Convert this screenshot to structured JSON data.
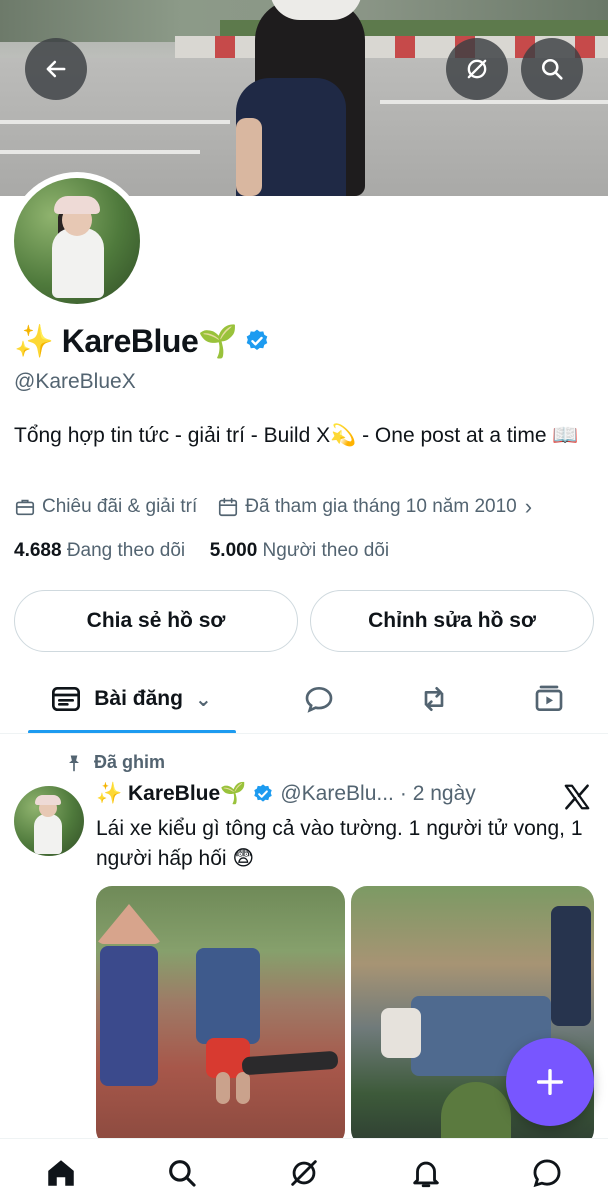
{
  "profile": {
    "name": "KareBlue",
    "name_prefix_emoji": "✨",
    "name_suffix_emoji": "🌱",
    "handle": "@KareBlueX",
    "bio": "Tổng hợp tin tức - giải trí - Build X💫 - One post at a time 📖",
    "category": "Chiêu đãi & giải trí",
    "joined": "Đã tham gia tháng 10 năm 2010",
    "following_count": "4.688",
    "following_label": "Đang theo dõi",
    "followers_count": "5.000",
    "followers_label": "Người theo dõi",
    "verified": true
  },
  "actions": {
    "share_label": "Chia sẻ hồ sơ",
    "edit_label": "Chỉnh sửa hồ sơ"
  },
  "tabs": {
    "posts_label": "Bài đăng"
  },
  "post": {
    "pinned_label": "Đã ghim",
    "author_name": "✨ KareBlue🌱",
    "author_handle": "@KareBlu...",
    "time": "· 2 ngày",
    "text": "Lái xe kiểu gì tông cả vào tường. 1 người tử vong, 1 người hấp hối 😨"
  },
  "colors": {
    "accent": "#1d9bf0",
    "fab": "#7856ff",
    "secondary_text": "#536471",
    "verified": "#1d9bf0"
  },
  "icons": {
    "back": "arrow-left-icon",
    "grok": "grok-icon",
    "search": "search-icon",
    "category": "briefcase-icon",
    "joined": "calendar-icon",
    "pinned": "pin-icon",
    "replies_tab": "speech-bubble-icon",
    "reposts_tab": "repost-icon",
    "media_tab": "video-icon",
    "fab": "plus-icon",
    "nav": [
      "home-icon",
      "search-icon",
      "grok-icon",
      "bell-icon",
      "message-icon"
    ]
  }
}
